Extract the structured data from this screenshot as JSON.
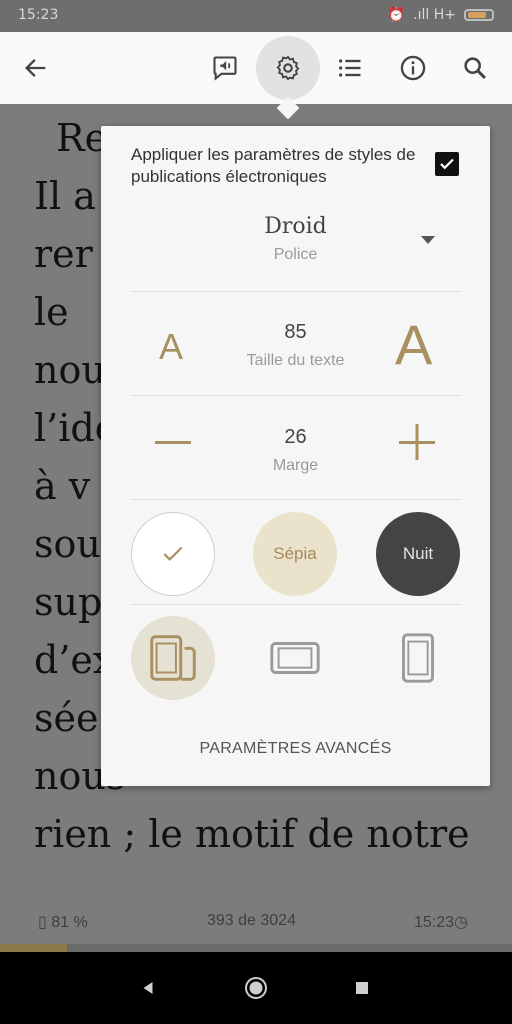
{
  "status_bar": {
    "time": "15:23",
    "network": ".ıll H+"
  },
  "toolbar": {
    "back": "back-arrow",
    "icons": [
      "speaker-bubble-icon",
      "gear-icon",
      "list-icon",
      "info-icon",
      "search-icon"
    ]
  },
  "reader": {
    "lines": [
      "Re",
      "Il a",
      "rer",
      "le",
      "nou",
      "l’ide",
      "à v",
      "sou",
      "sup",
      "d’ex",
      "sée",
      "nous",
      "rien ; le motif de notre"
    ],
    "battery": "81 %",
    "page": "393 de 3024",
    "clock": "15:23",
    "progress": 0.13
  },
  "settings": {
    "publisher_styles_label": "Appliquer les paramètres de styles de publications électroniques",
    "publisher_styles_checked": true,
    "font_name": "Droid",
    "font_label": "Police",
    "text_size": "85",
    "text_size_label": "Taille du texte",
    "small_a": "A",
    "large_a": "A",
    "margin": "26",
    "margin_label": "Marge",
    "themes": {
      "sepia": "Sépia",
      "night": "Nuit"
    },
    "selected_theme": "white",
    "advanced": "PARAMÈTRES AVANCÉS"
  },
  "colors": {
    "accent": "#a89060",
    "panel": "#f6f6f6",
    "night": "#444444",
    "sepia": "#ebe2cc"
  }
}
